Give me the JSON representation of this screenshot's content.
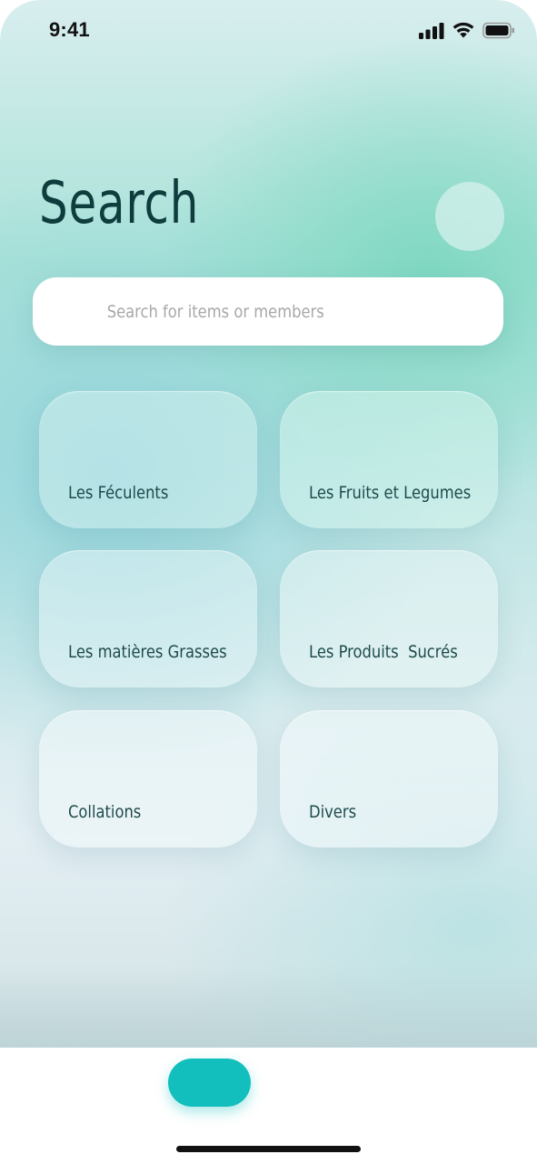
{
  "status_bar": {
    "time": "9:41",
    "icons": [
      "cellular-signal-icon",
      "wifi-icon",
      "battery-icon"
    ]
  },
  "header": {
    "title": "Search"
  },
  "search": {
    "placeholder": "Search for items or members",
    "value": ""
  },
  "categories": [
    {
      "label": "Les Féculents"
    },
    {
      "label": "Les Fruits et Legumes"
    },
    {
      "label": "Les matières Grasses"
    },
    {
      "label": "Les Produits  Sucrés"
    },
    {
      "label": "Collations"
    },
    {
      "label": "Divers"
    }
  ],
  "colors": {
    "accent": "#12bfbd",
    "title": "#0f3d3d",
    "card_text": "#1e4a4b",
    "placeholder": "#a7a7a7"
  }
}
